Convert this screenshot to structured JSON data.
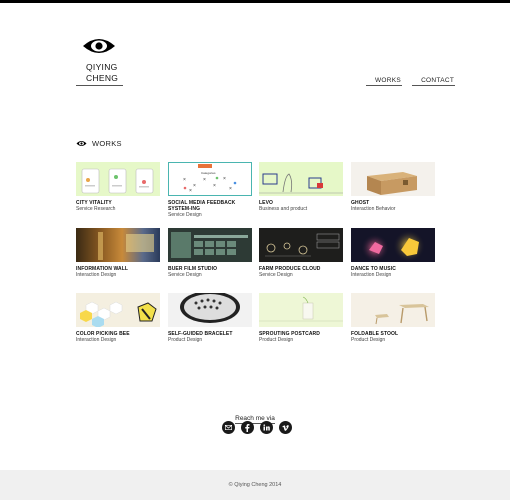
{
  "header": {
    "logo_line1": "QIYING",
    "logo_line2": "CHENG",
    "nav": [
      "WORKS",
      "CONTACT"
    ]
  },
  "section": {
    "title": "WORKS"
  },
  "works": [
    {
      "title": "CITY VITALITY",
      "subtitle": "Service Research"
    },
    {
      "title": "SOCIAL MEDIA FEEDBACK SYSTEM-ING",
      "subtitle": "Service Design"
    },
    {
      "title": "LEVO",
      "subtitle": "Business and product"
    },
    {
      "title": "GHOST",
      "subtitle": "Interaction Behavior"
    },
    {
      "title": "INFORMATION WALL",
      "subtitle": "Interaction Design"
    },
    {
      "title": "BUER FILM STUDIO",
      "subtitle": "Service Design"
    },
    {
      "title": "FARM PRODUCE CLOUD",
      "subtitle": "Service Design"
    },
    {
      "title": "DANCE TO MUSIC",
      "subtitle": "Interaction Design"
    },
    {
      "title": "COLOR PICKING BEE",
      "subtitle": "Interaction Design"
    },
    {
      "title": "SELF-GUIDED BRACELET",
      "subtitle": "Product Design"
    },
    {
      "title": "SPROUTING POSTCARD",
      "subtitle": "Product Design"
    },
    {
      "title": "FOLDABLE STOOL",
      "subtitle": "Product Design"
    }
  ],
  "contact": {
    "label": "Reach me via",
    "icons": [
      "email-icon",
      "facebook-icon",
      "linkedin-icon",
      "vimeo-icon"
    ]
  },
  "footer": {
    "text": "© Qiying Cheng 2014"
  },
  "colors": {
    "accent": "#e4f7c0",
    "dark": "#1a1a1a",
    "footer_bg": "#f0f0f0"
  }
}
